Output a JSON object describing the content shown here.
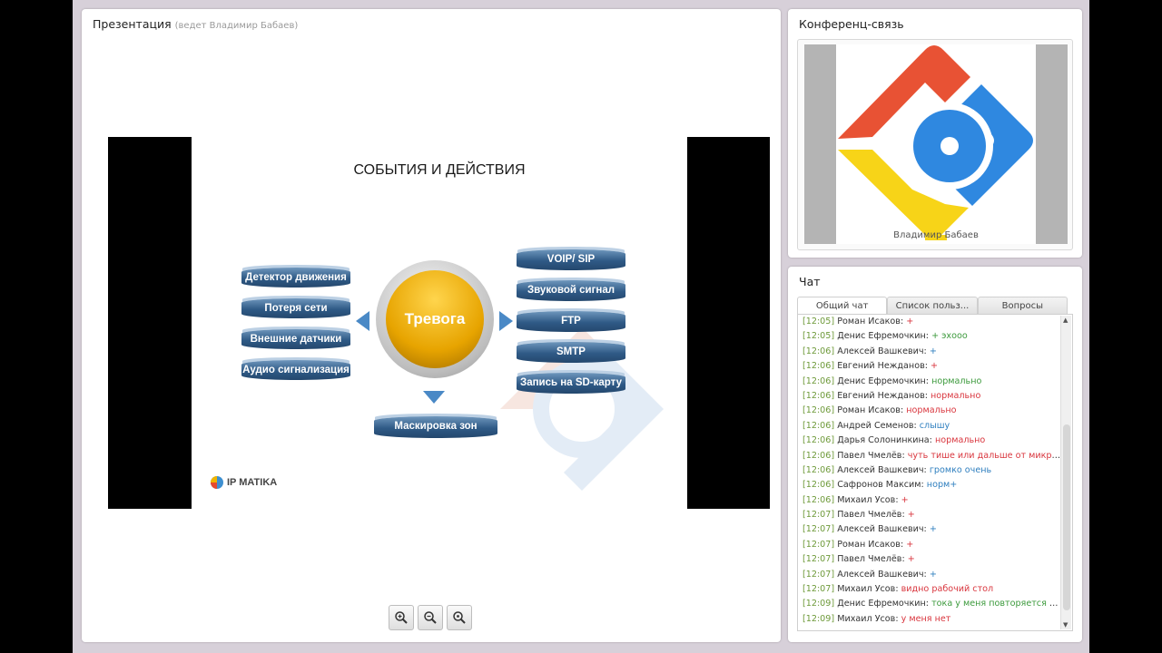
{
  "presentation": {
    "title": "Презентация",
    "presenter": "(ведет Владимир Бабаев)",
    "slide": {
      "heading": "СОБЫТИЯ И ДЕЙСТВИЯ",
      "center": "Тревога",
      "inputs": [
        "Детектор движения",
        "Потеря сети",
        "Внешние датчики",
        "Аудио сигнализация"
      ],
      "outputs": [
        "VOIP/ SIP",
        "Звуковой сигнал",
        "FTP",
        "SMTP",
        "Запись на SD-карту"
      ],
      "bottom": "Маскировка зон",
      "logo": "IP MATIKA"
    },
    "zoom_buttons": [
      "zoom-in-icon",
      "zoom-out-icon",
      "zoom-fit-icon"
    ]
  },
  "conference": {
    "title": "Конференц-связь",
    "speaker": "Владимир Бабаев"
  },
  "chat": {
    "title": "Чат",
    "tabs": [
      "Общий чат",
      "Список польз...",
      "Вопросы"
    ],
    "messages": [
      {
        "time": "[12:05]",
        "user": "Роман Исаков:",
        "text": "+",
        "color": "#d9363e"
      },
      {
        "time": "[12:05]",
        "user": "Денис Ефремочкин:",
        "text": "+ эхооо",
        "color": "#3c9a3c"
      },
      {
        "time": "[12:06]",
        "user": "Алексей Вашкевич:",
        "text": "+",
        "color": "#2f7fbf"
      },
      {
        "time": "[12:06]",
        "user": "Евгений Нежданов:",
        "text": "+",
        "color": "#d9363e"
      },
      {
        "time": "[12:06]",
        "user": "Денис Ефремочкин:",
        "text": "нормально",
        "color": "#3c9a3c"
      },
      {
        "time": "[12:06]",
        "user": "Евгений Нежданов:",
        "text": "нормально",
        "color": "#d9363e"
      },
      {
        "time": "[12:06]",
        "user": "Роман Исаков:",
        "text": "нормально",
        "color": "#d9363e"
      },
      {
        "time": "[12:06]",
        "user": "Андрей Семенов:",
        "text": "слышу",
        "color": "#2f7fbf"
      },
      {
        "time": "[12:06]",
        "user": "Дарья Солонинкина:",
        "text": "нормально",
        "color": "#d9363e"
      },
      {
        "time": "[12:06]",
        "user": "Павел Чмелёв:",
        "text": "чуть тише или дальше от микрофона...",
        "color": "#d9363e"
      },
      {
        "time": "[12:06]",
        "user": "Алексей Вашкевич:",
        "text": "громко очень",
        "color": "#2f7fbf"
      },
      {
        "time": "[12:06]",
        "user": "Сафронов Максим:",
        "text": "норм+",
        "color": "#2f7fbf"
      },
      {
        "time": "[12:06]",
        "user": "Михаил Усов:",
        "text": "+",
        "color": "#d9363e"
      },
      {
        "time": "[12:07]",
        "user": "Павел Чмелёв:",
        "text": "+",
        "color": "#d9363e"
      },
      {
        "time": "[12:07]",
        "user": "Алексей Вашкевич:",
        "text": "+",
        "color": "#2f7fbf"
      },
      {
        "time": "[12:07]",
        "user": "Роман Исаков:",
        "text": "+",
        "color": "#d9363e"
      },
      {
        "time": "[12:07]",
        "user": "Павел Чмелёв:",
        "text": "+",
        "color": "#d9363e"
      },
      {
        "time": "[12:07]",
        "user": "Алексей Вашкевич:",
        "text": "+",
        "color": "#2f7fbf"
      },
      {
        "time": "[12:07]",
        "user": "Михаил Усов:",
        "text": "видно рабочий стол",
        "color": "#d9363e"
      },
      {
        "time": "[12:09]",
        "user": "Денис Ефремочкин:",
        "text": "тока у меня повторяется звук ?",
        "color": "#3c9a3c"
      },
      {
        "time": "[12:09]",
        "user": "Михаил Усов:",
        "text": "у меня нет",
        "color": "#d9363e"
      }
    ]
  }
}
